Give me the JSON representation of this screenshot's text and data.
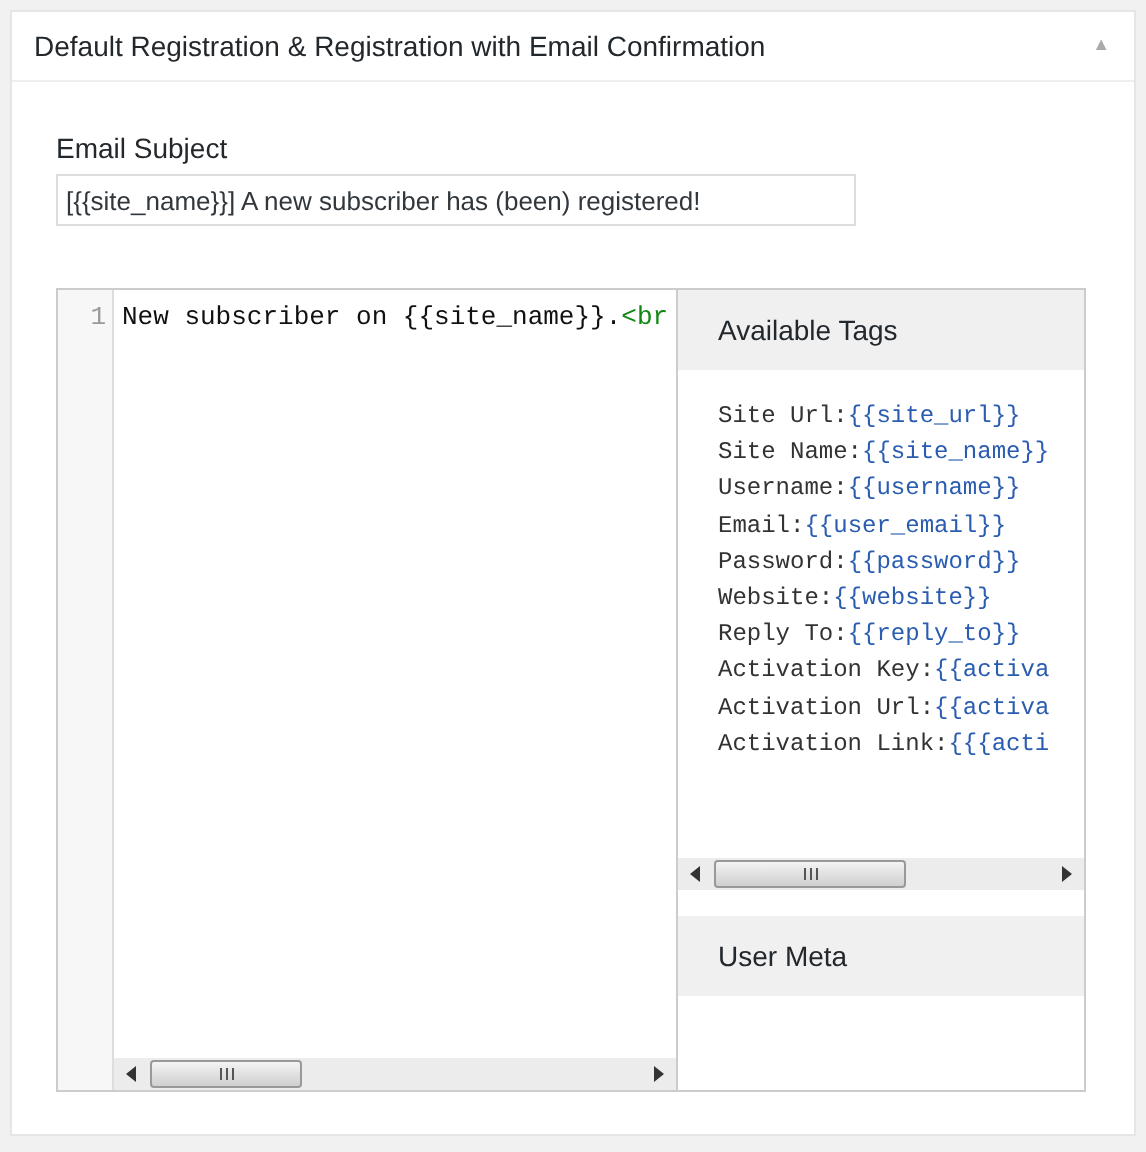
{
  "panel": {
    "title": "Default Registration & Registration with Email Confirmation",
    "collapse_icon": "▲"
  },
  "subject": {
    "label": "Email Subject",
    "value": "[{{site_name}}] A new subscriber has (been) registered!"
  },
  "editor": {
    "lines": [
      {
        "number": "1",
        "segments": [
          {
            "kind": "text",
            "text": "New subscriber on {{site_name}}."
          },
          {
            "kind": "tag",
            "text": "<br"
          }
        ]
      }
    ]
  },
  "sidebar": {
    "sections": [
      {
        "title": "Available Tags",
        "tags": [
          {
            "label": "Site Url:",
            "tag": "{{site_url}}"
          },
          {
            "label": "Site Name:",
            "tag": "{{site_name}}"
          },
          {
            "label": "Username:",
            "tag": "{{username}}"
          },
          {
            "label": "Email:",
            "tag": "{{user_email}}"
          },
          {
            "label": "Password:",
            "tag": "{{password}}"
          },
          {
            "label": "Website:",
            "tag": "{{website}}"
          },
          {
            "label": "Reply To:",
            "tag": "{{reply_to}}"
          },
          {
            "label": "Activation Key:",
            "tag": "{{activa"
          },
          {
            "label": "Activation Url:",
            "tag": "{{activa"
          },
          {
            "label": "Activation Link:",
            "tag": "{{{acti"
          }
        ]
      },
      {
        "title": "User Meta"
      }
    ]
  }
}
